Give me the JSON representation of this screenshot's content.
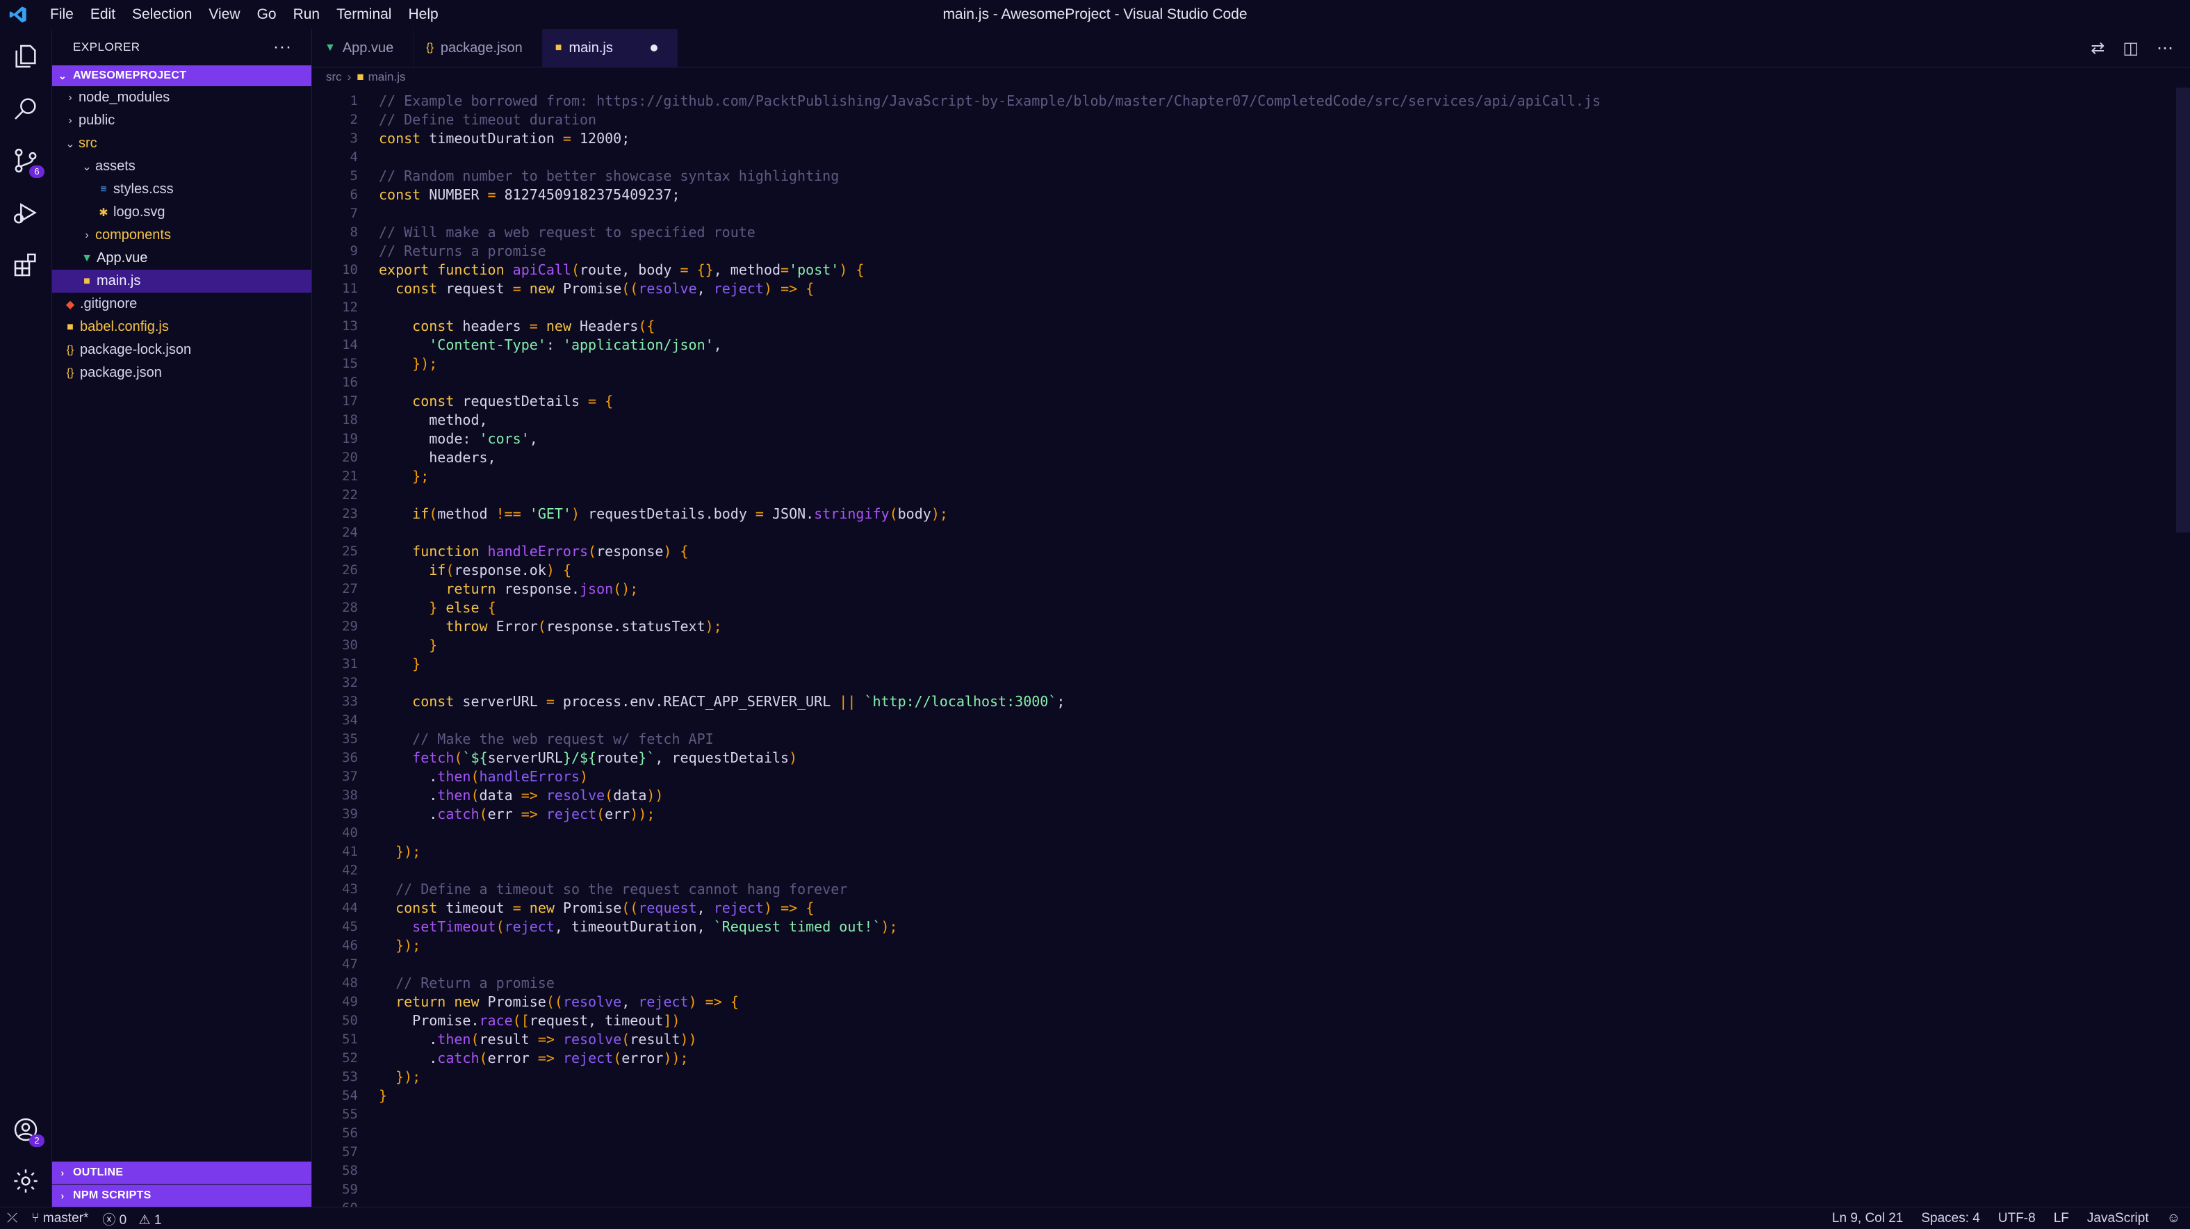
{
  "window": {
    "title": "main.js - AwesomeProject - Visual Studio Code",
    "menus": [
      "File",
      "Edit",
      "Selection",
      "View",
      "Go",
      "Run",
      "Terminal",
      "Help"
    ]
  },
  "colors": {
    "accent": "#7c3aed",
    "background": "#0c0a20",
    "keyword": "#f5c344",
    "string": "#86efac",
    "function": "#a855f7",
    "comment": "#5e5a82"
  },
  "activitybar": {
    "source_control_badge": "6",
    "accounts_badge": "2"
  },
  "sidebar": {
    "title": "EXPLORER",
    "more_label": "···",
    "project_label": "AWESOMEPROJECT",
    "tree": [
      {
        "label": "node_modules",
        "kind": "folder",
        "depth": 0,
        "open": false
      },
      {
        "label": "public",
        "kind": "folder",
        "depth": 0,
        "open": false
      },
      {
        "label": "src",
        "kind": "folder",
        "depth": 0,
        "open": true
      },
      {
        "label": "assets",
        "kind": "folder",
        "depth": 1,
        "open": true
      },
      {
        "label": "styles.css",
        "kind": "css",
        "depth": 2
      },
      {
        "label": "logo.svg",
        "kind": "svg",
        "depth": 2
      },
      {
        "label": "components",
        "kind": "folder",
        "depth": 1,
        "open": false
      },
      {
        "label": "App.vue",
        "kind": "vue",
        "depth": 1
      },
      {
        "label": "main.js",
        "kind": "js",
        "depth": 1,
        "active": true
      },
      {
        "label": ".gitignore",
        "kind": "git",
        "depth": 0
      },
      {
        "label": "babel.config.js",
        "kind": "js",
        "depth": 0
      },
      {
        "label": "package-lock.json",
        "kind": "json",
        "depth": 0
      },
      {
        "label": "package.json",
        "kind": "json",
        "depth": 0
      }
    ],
    "outline_label": "OUTLINE",
    "npm_scripts_label": "NPM SCRIPTS"
  },
  "tabs": [
    {
      "label": "App.vue",
      "kind": "vue",
      "active": false
    },
    {
      "label": "package.json",
      "kind": "json",
      "active": false
    },
    {
      "label": "main.js",
      "kind": "js",
      "active": true,
      "dirty": true
    }
  ],
  "breadcrumb": {
    "folder": "src",
    "file": "main.js"
  },
  "editor": {
    "line_count": 60,
    "lines": [
      [
        [
          "c",
          "// Example borrowed from: https://github.com/PacktPublishing/JavaScript-by-Example/blob/master/Chapter07/CompletedCode/src/services/api/apiCall.js"
        ]
      ],
      [
        [
          "c",
          "// Define timeout duration"
        ]
      ],
      [
        [
          "k",
          "const"
        ],
        [
          "x",
          " timeoutDuration "
        ],
        [
          "o",
          "="
        ],
        [
          "x",
          " 12000;"
        ]
      ],
      [],
      [
        [
          "c",
          "// Random number to better showcase syntax highlighting"
        ]
      ],
      [
        [
          "k",
          "const"
        ],
        [
          "x",
          " NUMBER "
        ],
        [
          "o",
          "="
        ],
        [
          "x",
          " 81274509182375409237;"
        ]
      ],
      [],
      [
        [
          "c",
          "// Will make a web request to specified route"
        ]
      ],
      [
        [
          "c",
          "// Returns a promise"
        ]
      ],
      [
        [
          "k",
          "export function"
        ],
        [
          "x",
          " "
        ],
        [
          "f",
          "apiCall"
        ],
        [
          "o",
          "("
        ],
        [
          "x",
          "route, body "
        ],
        [
          "o",
          "="
        ],
        [
          "x",
          " "
        ],
        [
          "o",
          "{}"
        ],
        [
          "x",
          ", method"
        ],
        [
          "o",
          "="
        ],
        [
          "s",
          "'post'"
        ],
        [
          "o",
          ")"
        ],
        [
          "x",
          " "
        ],
        [
          "o",
          "{"
        ]
      ],
      [
        [
          "x",
          "  "
        ],
        [
          "k",
          "const"
        ],
        [
          "x",
          " request "
        ],
        [
          "o",
          "="
        ],
        [
          "x",
          " "
        ],
        [
          "k",
          "new"
        ],
        [
          "x",
          " Promise"
        ],
        [
          "o",
          "(("
        ],
        [
          "p",
          "resolve"
        ],
        [
          "x",
          ", "
        ],
        [
          "p",
          "reject"
        ],
        [
          "o",
          ")"
        ],
        [
          "x",
          " "
        ],
        [
          "o",
          "=>"
        ],
        [
          "x",
          " "
        ],
        [
          "o",
          "{"
        ]
      ],
      [],
      [
        [
          "x",
          "    "
        ],
        [
          "k",
          "const"
        ],
        [
          "x",
          " headers "
        ],
        [
          "o",
          "="
        ],
        [
          "x",
          " "
        ],
        [
          "k",
          "new"
        ],
        [
          "x",
          " Headers"
        ],
        [
          "o",
          "({"
        ]
      ],
      [
        [
          "x",
          "      "
        ],
        [
          "s",
          "'Content-Type'"
        ],
        [
          "x",
          ": "
        ],
        [
          "s",
          "'application/json'"
        ],
        [
          "x",
          ","
        ]
      ],
      [
        [
          "x",
          "    "
        ],
        [
          "o",
          "});"
        ]
      ],
      [],
      [
        [
          "x",
          "    "
        ],
        [
          "k",
          "const"
        ],
        [
          "x",
          " requestDetails "
        ],
        [
          "o",
          "="
        ],
        [
          "x",
          " "
        ],
        [
          "o",
          "{"
        ]
      ],
      [
        [
          "x",
          "      method,"
        ]
      ],
      [
        [
          "x",
          "      mode: "
        ],
        [
          "s",
          "'cors'"
        ],
        [
          "x",
          ","
        ]
      ],
      [
        [
          "x",
          "      headers,"
        ]
      ],
      [
        [
          "x",
          "    "
        ],
        [
          "o",
          "};"
        ]
      ],
      [],
      [
        [
          "x",
          "    "
        ],
        [
          "k",
          "if"
        ],
        [
          "o",
          "("
        ],
        [
          "x",
          "method "
        ],
        [
          "o",
          "!=="
        ],
        [
          "x",
          " "
        ],
        [
          "s",
          "'GET'"
        ],
        [
          "o",
          ")"
        ],
        [
          "x",
          " requestDetails.body "
        ],
        [
          "o",
          "="
        ],
        [
          "x",
          " JSON."
        ],
        [
          "f",
          "stringify"
        ],
        [
          "o",
          "("
        ],
        [
          "x",
          "body"
        ],
        [
          "o",
          ");"
        ]
      ],
      [],
      [
        [
          "x",
          "    "
        ],
        [
          "k",
          "function"
        ],
        [
          "x",
          " "
        ],
        [
          "f",
          "handleErrors"
        ],
        [
          "o",
          "("
        ],
        [
          "x",
          "response"
        ],
        [
          "o",
          ")"
        ],
        [
          "x",
          " "
        ],
        [
          "o",
          "{"
        ]
      ],
      [
        [
          "x",
          "      "
        ],
        [
          "k",
          "if"
        ],
        [
          "o",
          "("
        ],
        [
          "x",
          "response.ok"
        ],
        [
          "o",
          ")"
        ],
        [
          "x",
          " "
        ],
        [
          "o",
          "{"
        ]
      ],
      [
        [
          "x",
          "        "
        ],
        [
          "k",
          "return"
        ],
        [
          "x",
          " response."
        ],
        [
          "f",
          "json"
        ],
        [
          "o",
          "();"
        ]
      ],
      [
        [
          "x",
          "      "
        ],
        [
          "o",
          "}"
        ],
        [
          "x",
          " "
        ],
        [
          "k",
          "else"
        ],
        [
          "x",
          " "
        ],
        [
          "o",
          "{"
        ]
      ],
      [
        [
          "x",
          "        "
        ],
        [
          "k",
          "throw"
        ],
        [
          "x",
          " Error"
        ],
        [
          "o",
          "("
        ],
        [
          "x",
          "response.statusText"
        ],
        [
          "o",
          ");"
        ]
      ],
      [
        [
          "x",
          "      "
        ],
        [
          "o",
          "}"
        ]
      ],
      [
        [
          "x",
          "    "
        ],
        [
          "o",
          "}"
        ]
      ],
      [],
      [
        [
          "x",
          "    "
        ],
        [
          "k",
          "const"
        ],
        [
          "x",
          " serverURL "
        ],
        [
          "o",
          "="
        ],
        [
          "x",
          " process.env.REACT_APP_SERVER_URL "
        ],
        [
          "o",
          "||"
        ],
        [
          "x",
          " "
        ],
        [
          "s",
          "`http://localhost:3000`"
        ],
        [
          "x",
          ";"
        ]
      ],
      [],
      [
        [
          "x",
          "    "
        ],
        [
          "c",
          "// Make the web request w/ fetch API"
        ]
      ],
      [
        [
          "x",
          "    "
        ],
        [
          "f",
          "fetch"
        ],
        [
          "o",
          "("
        ],
        [
          "s",
          "`${"
        ],
        [
          "x",
          "serverURL"
        ],
        [
          "s",
          "}/${"
        ],
        [
          "x",
          "route"
        ],
        [
          "s",
          "}`"
        ],
        [
          "x",
          ", requestDetails"
        ],
        [
          "o",
          ")"
        ]
      ],
      [
        [
          "x",
          "      ."
        ],
        [
          "f",
          "then"
        ],
        [
          "o",
          "("
        ],
        [
          "p",
          "handleErrors"
        ],
        [
          "o",
          ")"
        ]
      ],
      [
        [
          "x",
          "      ."
        ],
        [
          "f",
          "then"
        ],
        [
          "o",
          "("
        ],
        [
          "x",
          "data "
        ],
        [
          "o",
          "=>"
        ],
        [
          "x",
          " "
        ],
        [
          "p",
          "resolve"
        ],
        [
          "o",
          "("
        ],
        [
          "x",
          "data"
        ],
        [
          "o",
          "))"
        ]
      ],
      [
        [
          "x",
          "      ."
        ],
        [
          "f",
          "catch"
        ],
        [
          "o",
          "("
        ],
        [
          "x",
          "err "
        ],
        [
          "o",
          "=>"
        ],
        [
          "x",
          " "
        ],
        [
          "p",
          "reject"
        ],
        [
          "o",
          "("
        ],
        [
          "x",
          "err"
        ],
        [
          "o",
          "));"
        ]
      ],
      [],
      [
        [
          "x",
          "  "
        ],
        [
          "o",
          "});"
        ]
      ],
      [],
      [
        [
          "x",
          "  "
        ],
        [
          "c",
          "// Define a timeout so the request cannot hang forever"
        ]
      ],
      [
        [
          "x",
          "  "
        ],
        [
          "k",
          "const"
        ],
        [
          "x",
          " timeout "
        ],
        [
          "o",
          "="
        ],
        [
          "x",
          " "
        ],
        [
          "k",
          "new"
        ],
        [
          "x",
          " Promise"
        ],
        [
          "o",
          "(("
        ],
        [
          "p",
          "request"
        ],
        [
          "x",
          ", "
        ],
        [
          "p",
          "reject"
        ],
        [
          "o",
          ")"
        ],
        [
          "x",
          " "
        ],
        [
          "o",
          "=>"
        ],
        [
          "x",
          " "
        ],
        [
          "o",
          "{"
        ]
      ],
      [
        [
          "x",
          "    "
        ],
        [
          "f",
          "setTimeout"
        ],
        [
          "o",
          "("
        ],
        [
          "p",
          "reject"
        ],
        [
          "x",
          ", timeoutDuration, "
        ],
        [
          "s",
          "`Request timed out!`"
        ],
        [
          "o",
          ");"
        ]
      ],
      [
        [
          "x",
          "  "
        ],
        [
          "o",
          "});"
        ]
      ],
      [],
      [
        [
          "x",
          "  "
        ],
        [
          "c",
          "// Return a promise"
        ]
      ],
      [
        [
          "x",
          "  "
        ],
        [
          "k",
          "return new"
        ],
        [
          "x",
          " Promise"
        ],
        [
          "o",
          "(("
        ],
        [
          "p",
          "resolve"
        ],
        [
          "x",
          ", "
        ],
        [
          "p",
          "reject"
        ],
        [
          "o",
          ")"
        ],
        [
          "x",
          " "
        ],
        [
          "o",
          "=>"
        ],
        [
          "x",
          " "
        ],
        [
          "o",
          "{"
        ]
      ],
      [
        [
          "x",
          "    Promise."
        ],
        [
          "f",
          "race"
        ],
        [
          "o",
          "(["
        ],
        [
          "x",
          "request, timeout"
        ],
        [
          "o",
          "])"
        ]
      ],
      [
        [
          "x",
          "      ."
        ],
        [
          "f",
          "then"
        ],
        [
          "o",
          "("
        ],
        [
          "x",
          "result "
        ],
        [
          "o",
          "=>"
        ],
        [
          "x",
          " "
        ],
        [
          "p",
          "resolve"
        ],
        [
          "o",
          "("
        ],
        [
          "x",
          "result"
        ],
        [
          "o",
          "))"
        ]
      ],
      [
        [
          "x",
          "      ."
        ],
        [
          "f",
          "catch"
        ],
        [
          "o",
          "("
        ],
        [
          "x",
          "error "
        ],
        [
          "o",
          "=>"
        ],
        [
          "x",
          " "
        ],
        [
          "p",
          "reject"
        ],
        [
          "o",
          "("
        ],
        [
          "x",
          "error"
        ],
        [
          "o",
          "));"
        ]
      ],
      [
        [
          "x",
          "  "
        ],
        [
          "o",
          "});"
        ]
      ],
      [
        [
          "o",
          "}"
        ]
      ],
      [],
      [],
      [],
      [],
      [],
      []
    ]
  },
  "statusbar": {
    "branch": "master*",
    "errors": "0",
    "warnings": "1",
    "position": "Ln 9, Col 21",
    "spaces": "Spaces: 4",
    "encoding": "UTF-8",
    "eol": "LF",
    "language": "JavaScript"
  }
}
